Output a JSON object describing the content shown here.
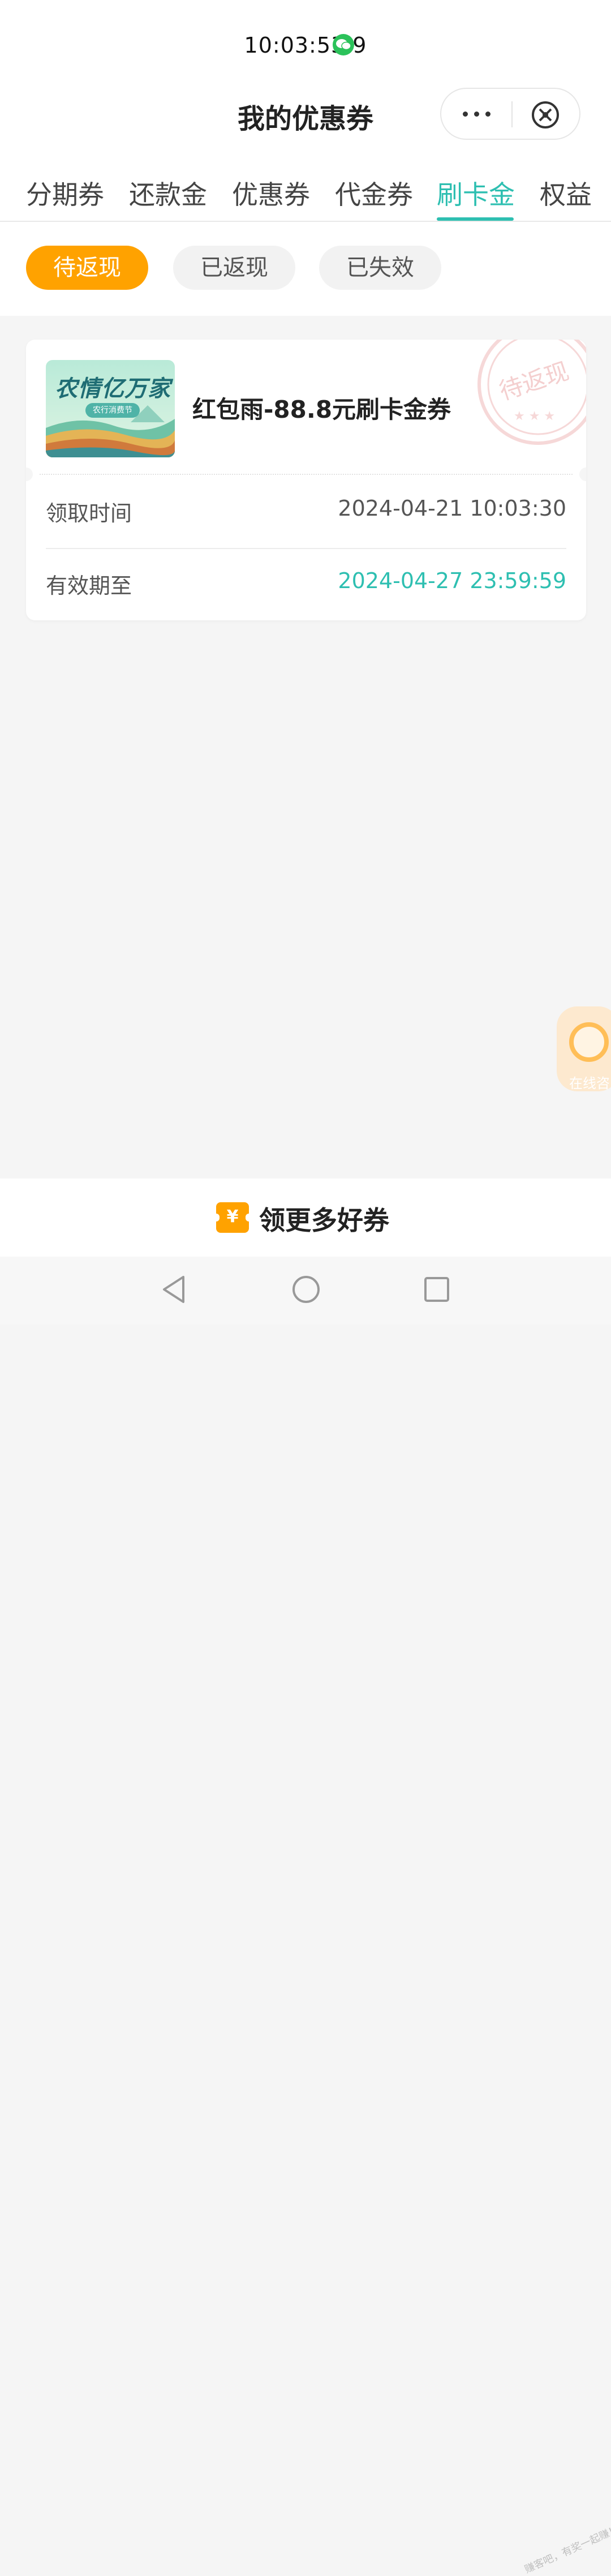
{
  "status": {
    "time": "10:03:53.9"
  },
  "header": {
    "title": "我的优惠券"
  },
  "tabs": [
    {
      "label": "分期券"
    },
    {
      "label": "还款金"
    },
    {
      "label": "优惠券"
    },
    {
      "label": "代金券"
    },
    {
      "label": "刷卡金",
      "active": true
    },
    {
      "label": "权益"
    }
  ],
  "filters": [
    {
      "label": "待返现",
      "active": true
    },
    {
      "label": "已返现"
    },
    {
      "label": "已失效"
    }
  ],
  "coupon": {
    "thumb_title": "农情亿万家",
    "thumb_subtitle": "农行消费节",
    "title": "红包雨-88.8元刷卡金券",
    "stamp": "待返现",
    "received_label": "领取时间",
    "received_value": "2024-04-21 10:03:30",
    "valid_label": "有效期至",
    "valid_value": "2024-04-27 23:59:59"
  },
  "float_service": {
    "label": "在线咨"
  },
  "bottom": {
    "ticket_symbol": "¥",
    "cta": "领更多好券"
  },
  "watermark": "赚客吧，有奖一起赚！",
  "colors": {
    "accent": "#2ebfb1",
    "orange": "#ffa200"
  },
  "icons": [
    "wechat-icon",
    "more-icon",
    "close-circle-icon",
    "ticket-icon",
    "back-icon",
    "home-icon",
    "recent-apps-icon"
  ]
}
